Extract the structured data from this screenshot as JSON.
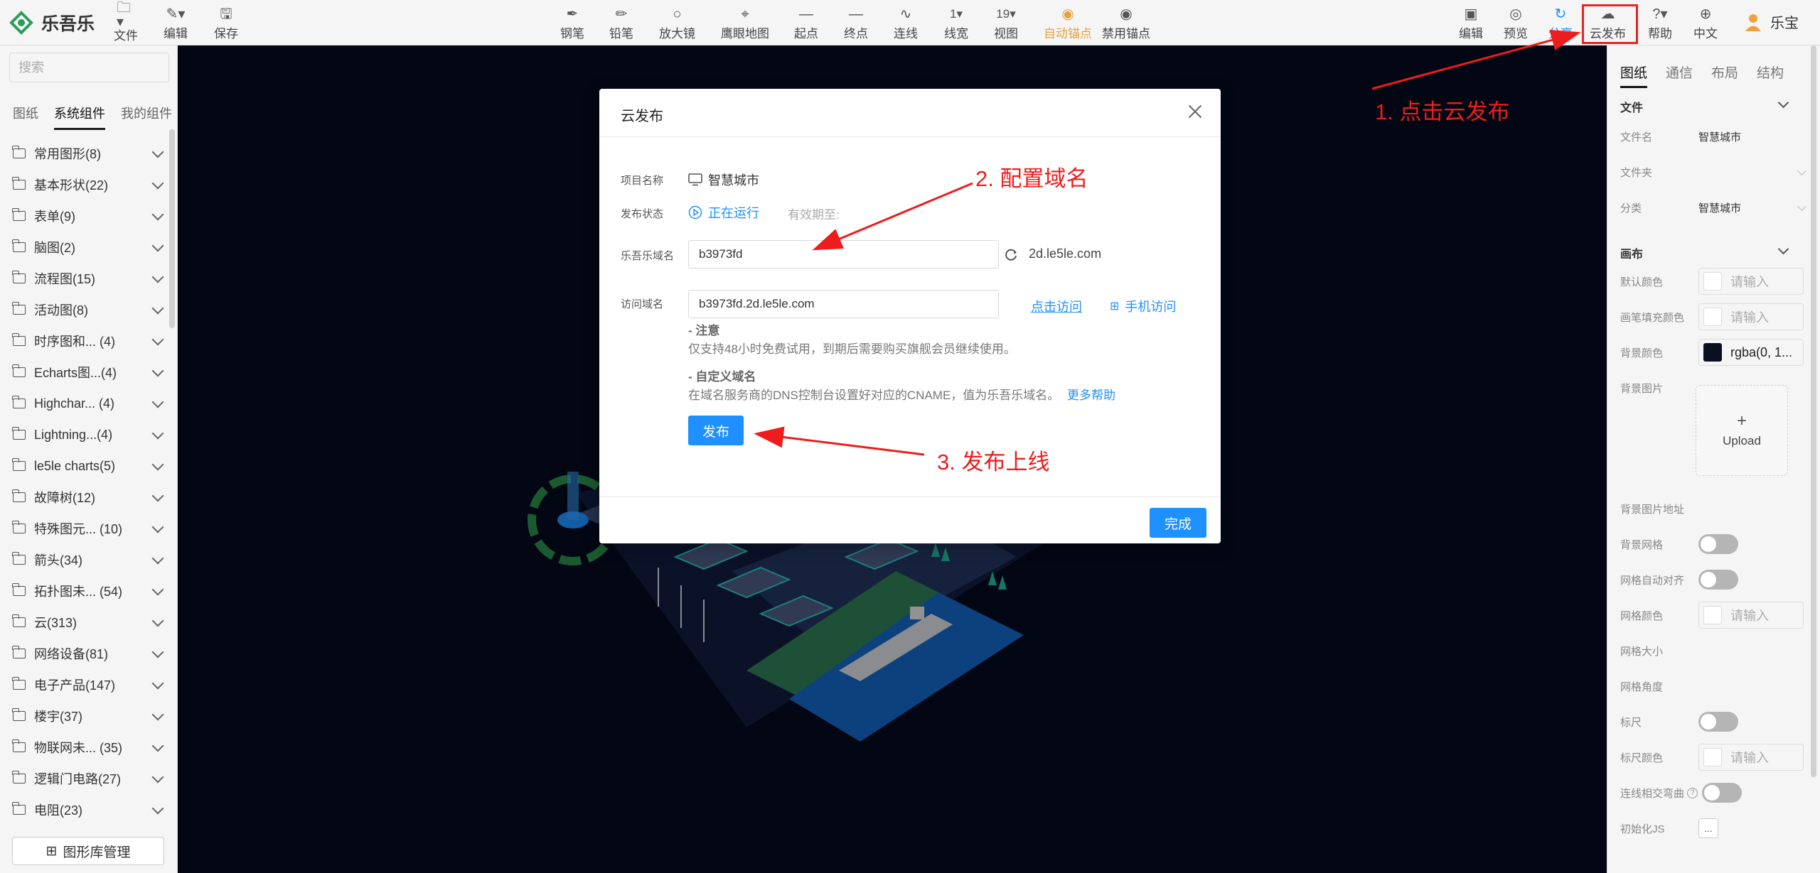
{
  "app": {
    "logo_text": "乐吾乐"
  },
  "toolbar": {
    "left": [
      {
        "label": "文件",
        "icon": "folder-icon"
      },
      {
        "label": "编辑",
        "icon": "edit-icon"
      },
      {
        "label": "保存",
        "icon": "save-icon"
      }
    ],
    "center": [
      {
        "label": "钢笔",
        "icon": "pen-icon"
      },
      {
        "label": "铅笔",
        "icon": "pencil-icon"
      },
      {
        "label": "放大镜",
        "icon": "magnifier-icon"
      },
      {
        "label": "鹰眼地图",
        "icon": "map-pin-icon"
      },
      {
        "label": "起点",
        "icon": "line-start-icon"
      },
      {
        "label": "终点",
        "icon": "line-end-icon"
      },
      {
        "label": "连线",
        "icon": "curve-icon"
      },
      {
        "label": "线宽",
        "icon": "line-width-icon",
        "value": "1"
      },
      {
        "label": "视图",
        "icon": "view-icon",
        "value": "19"
      },
      {
        "label": "自动锚点",
        "icon": "anchor-icon"
      },
      {
        "label": "禁用锚点",
        "icon": "anchor-disabled-icon"
      }
    ],
    "right": [
      {
        "label": "编辑",
        "icon": "edit-mode-icon"
      },
      {
        "label": "预览",
        "icon": "eye-icon"
      },
      {
        "label": "分享",
        "icon": "share-icon"
      },
      {
        "label": "云发布",
        "icon": "cloud-icon"
      },
      {
        "label": "帮助",
        "icon": "help-icon"
      },
      {
        "label": "中文",
        "icon": "globe-icon"
      }
    ],
    "user": "乐宝"
  },
  "sidebar": {
    "search_placeholder": "搜索",
    "tabs": [
      "图纸",
      "系统组件",
      "我的组件"
    ],
    "active_tab": 1,
    "categories": [
      "常用图形(8)",
      "基本形状(22)",
      "表单(9)",
      "脑图(2)",
      "流程图(15)",
      "活动图(8)",
      "时序图和... (4)",
      "Echarts图...(4)",
      "Highchar... (4)",
      "Lightning...(4)",
      "le5le charts(5)",
      "故障树(12)",
      "特殊图元... (10)",
      "箭头(34)",
      "拓扑图未... (54)",
      "云(313)",
      "网络设备(81)",
      "电子产品(147)",
      "楼宇(37)",
      "物联网未... (35)",
      "逻辑门电路(27)",
      "电阻(23)"
    ],
    "library_button": "图形库管理"
  },
  "right_panel": {
    "tabs": [
      "图纸",
      "通信",
      "布局",
      "结构"
    ],
    "active_tab": 0,
    "file_section": "文件",
    "file_name_label": "文件名",
    "file_name": "智慧城市",
    "folder_label": "文件夹",
    "category_label": "分类",
    "category": "智慧城市",
    "canvas_section": "画布",
    "default_color_label": "默认颜色",
    "pen_fill_label": "画笔填充颜色",
    "bg_color_label": "背景颜色",
    "bg_color_value": "rgba(0, 1...",
    "bg_image_label": "背景图片",
    "upload_label": "Upload",
    "bg_image_url_label": "背景图片地址",
    "grid_label": "背景网格",
    "grid_snap_label": "网格自动对齐",
    "grid_color_label": "网格颜色",
    "grid_size_label": "网格大小",
    "grid_angle_label": "网格角度",
    "ruler_label": "标尺",
    "ruler_color_label": "标尺颜色",
    "line_cross_label": "连线相交弯曲",
    "init_js_label": "初始化JS",
    "init_js_button": "...",
    "placeholder": "请输入"
  },
  "modal": {
    "title": "云发布",
    "project_label": "项目名称",
    "project_name": "智慧城市",
    "status_label": "发布状态",
    "status": "正在运行",
    "expire_label": "有效期至:",
    "domain_label": "乐吾乐域名",
    "domain_value": "b3973fd",
    "domain_suffix": "2d.le5le.com",
    "access_label": "访问域名",
    "access_value": "b3973fd.2d.le5le.com",
    "visit_link": "点击访问",
    "mobile_link": "手机访问",
    "note_title": "- 注意",
    "note_text": "仅支持48小时免费试用，到期后需要购买旗舰会员继续使用。",
    "custom_title": "- 自定义域名",
    "custom_text": "在域名服务商的DNS控制台设置好对应的CNAME，值为乐吾乐域名。",
    "more_help": "更多帮助",
    "publish_button": "发布",
    "done_button": "完成"
  },
  "annotations": {
    "step1": "1. 点击云发布",
    "step2": "2. 配置域名",
    "step3": "3. 发布上线"
  },
  "colors": {
    "accent": "#1e90ff",
    "anno": "#ee1c1c",
    "auto_anchor": "#e6a23c",
    "canvas_bg": "#050b1f"
  }
}
